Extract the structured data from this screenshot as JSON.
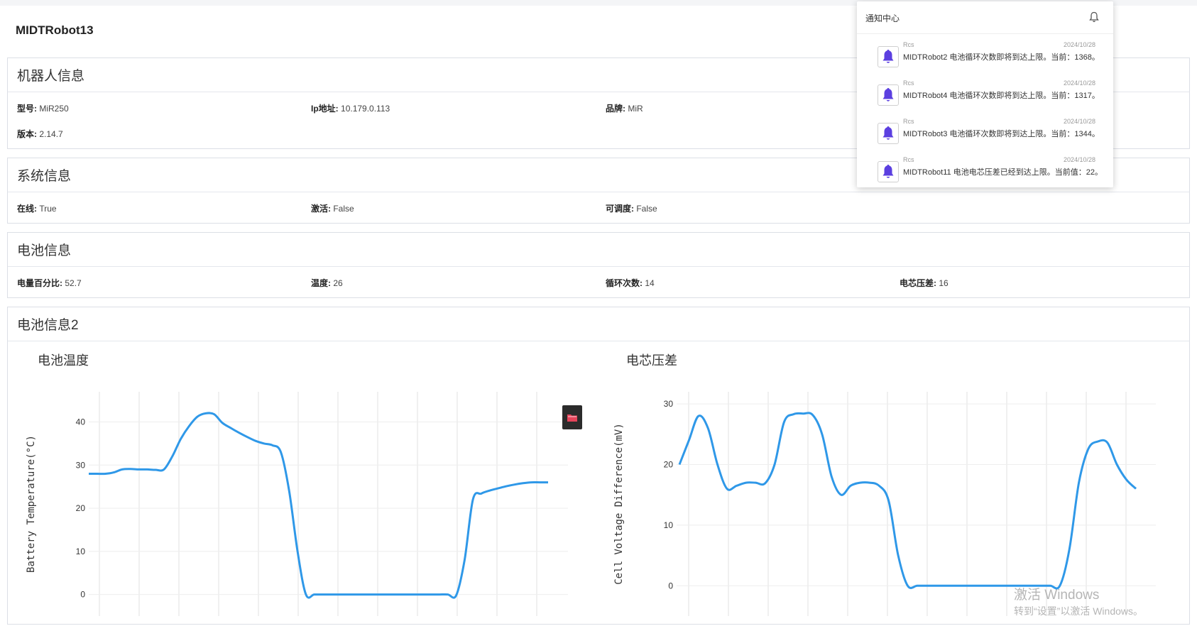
{
  "page": {
    "title": "MIDTRobot13"
  },
  "robot_info": {
    "header": "机器人信息",
    "fields": [
      {
        "label": "型号:",
        "value": "MiR250"
      },
      {
        "label": "Ip地址:",
        "value": "10.179.0.113"
      },
      {
        "label": "品牌:",
        "value": "MiR"
      },
      {
        "label": "版本:",
        "value": "2.14.7"
      }
    ]
  },
  "system_info": {
    "header": "系统信息",
    "fields": [
      {
        "label": "在线:",
        "value": "True"
      },
      {
        "label": "激活:",
        "value": "False"
      },
      {
        "label": "可调度:",
        "value": "False"
      }
    ]
  },
  "battery_info": {
    "header": "电池信息",
    "fields": [
      {
        "label": "电量百分比:",
        "value": "52.7"
      },
      {
        "label": "温度:",
        "value": "26"
      },
      {
        "label": "循环次数:",
        "value": "14"
      },
      {
        "label": "电芯压差:",
        "value": "16"
      }
    ]
  },
  "battery_info2": {
    "header": "电池信息2"
  },
  "notifications": {
    "title": "通知中心",
    "bell_icon": "bell-icon",
    "items": [
      {
        "source": "Rcs",
        "date": "2024/10/28",
        "message": "MIDTRobot2 电池循环次数即将到达上限。当前：1368。"
      },
      {
        "source": "Rcs",
        "date": "2024/10/28",
        "message": "MIDTRobot4 电池循环次数即将到达上限。当前：1317。"
      },
      {
        "source": "Rcs",
        "date": "2024/10/28",
        "message": "MIDTRobot3 电池循环次数即将到达上限。当前：1344。"
      },
      {
        "source": "Rcs",
        "date": "2024/10/28",
        "message": "MIDTRobot11 电池电芯压差已经到达上限。当前值：22。"
      }
    ]
  },
  "folder_button": {
    "icon": "folder-icon",
    "color": "#e5445a"
  },
  "watermark": {
    "line1": "激活 Windows",
    "line2": "转到“设置”以激活 Windows。"
  },
  "colors": {
    "line": "#2f98e8",
    "bell": "#5b3fe0"
  },
  "chart_data": [
    {
      "type": "line",
      "title": "电池温度",
      "xlabel": "",
      "ylabel": "Battery Temperature(°C)",
      "ylim": [
        -5,
        47
      ],
      "yticks": [
        0,
        10,
        20,
        30,
        40
      ],
      "x": [
        0,
        1,
        2,
        3,
        4,
        5,
        6,
        7,
        8,
        9,
        10,
        11,
        12,
        13,
        14,
        15,
        16,
        17,
        18,
        19,
        20,
        21,
        22,
        23,
        24,
        25,
        26,
        27,
        28,
        29,
        30,
        31,
        32,
        33,
        34,
        35,
        36,
        37,
        38,
        39,
        40,
        41,
        42,
        43,
        44,
        45,
        46,
        47
      ],
      "series": [
        {
          "values": [
            28,
            28,
            28,
            28.3,
            29,
            29.1,
            29,
            29,
            28.9,
            29,
            32,
            36,
            39,
            41.2,
            42,
            41.8,
            39.8,
            38.6,
            37.5,
            36.5,
            35.6,
            35,
            34.6,
            33,
            24,
            10,
            0,
            0,
            0,
            0,
            0,
            0,
            0,
            0,
            0,
            0,
            0,
            0,
            0,
            0,
            0,
            0,
            0,
            0,
            -0.2,
            8,
            22,
            23.4,
            24.1,
            24.6,
            25.1,
            25.5,
            25.8,
            26,
            26,
            26
          ]
        }
      ]
    },
    {
      "type": "line",
      "title": "电芯压差",
      "xlabel": "",
      "ylabel": "Cell Voltage Difference(mV)",
      "ylim": [
        -5,
        32
      ],
      "yticks": [
        0,
        10,
        20,
        30
      ],
      "x": [
        0,
        1,
        2,
        3,
        4,
        5,
        6,
        7,
        8,
        9,
        10,
        11,
        12,
        13,
        14,
        15,
        16,
        17,
        18,
        19,
        20,
        21,
        22,
        23,
        24,
        25,
        26,
        27,
        28,
        29,
        30,
        31,
        32,
        33,
        34,
        35,
        36,
        37,
        38,
        39,
        40,
        41,
        42,
        43,
        44,
        45,
        46,
        47,
        48
      ],
      "series": [
        {
          "values": [
            20,
            24,
            28,
            26,
            20,
            16,
            16.5,
            17,
            17,
            16.9,
            20,
            27,
            28.3,
            28.4,
            28.2,
            25,
            18,
            15,
            16.5,
            17,
            17,
            16.5,
            14,
            5,
            0,
            0,
            0,
            0,
            0,
            0,
            0,
            0,
            0,
            0,
            0,
            0,
            0,
            0,
            0,
            0,
            0,
            6,
            17,
            22.6,
            23.8,
            23.6,
            20,
            17.5,
            16
          ]
        }
      ]
    }
  ]
}
